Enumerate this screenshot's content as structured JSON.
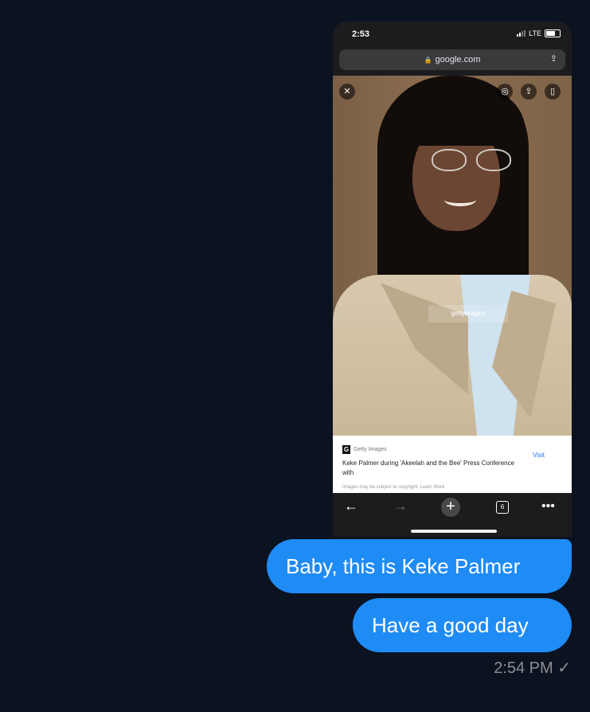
{
  "phone": {
    "status_time": "2:53",
    "network": "LTE",
    "url": "google.com",
    "card": {
      "source": "Getty Images",
      "title": "Keke Palmer during 'Akeelah and the Bee' Press Conference with",
      "visit_label": "Visit",
      "footer": "Images may be subject to copyright. Learn More"
    },
    "tabs_count": "6",
    "watermark": "gettyimages"
  },
  "messages": [
    {
      "text": "Baby, this is Keke Palmer"
    },
    {
      "text": "Have a good day"
    }
  ],
  "meta": {
    "time": "2:54 PM",
    "status_icon": "checkmark-icon"
  },
  "colors": {
    "bubble": "#1f8bf5",
    "background": "#0b1220"
  }
}
